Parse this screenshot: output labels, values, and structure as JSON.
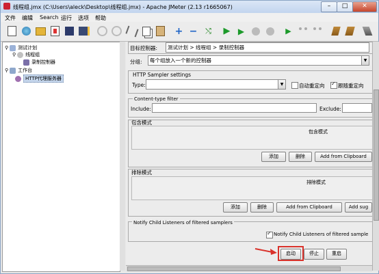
{
  "window": {
    "title": "线程组.jmx (C:\\Users\\aleck\\Desktop\\线程组.jmx) - Apache JMeter (2.13 r1665067)",
    "min_label": "–",
    "max_label": "□",
    "close_label": "✕"
  },
  "menu": [
    "文件",
    "编辑",
    "Search",
    "运行",
    "选项",
    "帮助"
  ],
  "toolbar": {
    "icons": [
      "new-icon",
      "templates-icon",
      "open-icon",
      "close-file-icon",
      "save-icon",
      "save-as-icon",
      "cut-icon",
      "copy-icon",
      "paste-icon",
      "expand-icon",
      "collapse-icon",
      "toggle-icon",
      "start-icon",
      "start-no-pause-icon",
      "stop-icon",
      "shutdown-icon",
      "remote-start-icon",
      "remote-stop-icon",
      "remote-shutdown-icon",
      "clear-icon",
      "clear-all-icon",
      "search-icon"
    ]
  },
  "tree": {
    "nodes": [
      {
        "label": "测试计划",
        "icon": "test-plan-icon"
      },
      {
        "label": "线程组",
        "icon": "thread-group-icon"
      },
      {
        "label": "录制控制器",
        "icon": "recording-controller-icon"
      },
      {
        "label": "工作台",
        "icon": "workbench-icon"
      },
      {
        "label": "HTTP代理服务器",
        "icon": "http-proxy-icon"
      }
    ]
  },
  "form": {
    "target_label": "目标控制器:",
    "target_value": "测试计划 > 线程组 > 录制控制器",
    "grouping_label": "分组:",
    "grouping_value": "每个组放入一个新的控制器",
    "sampler_settings_title": "HTTP Sampler settings",
    "type_label": "Type:",
    "type_value": "",
    "redirect_label": "自动重定向",
    "follow_redirect_label": "跟随重定向",
    "content_filter_title": "Content-type filter",
    "include_label": "Include:",
    "exclude_label": "Exclude:",
    "include_section_title": "包含模式",
    "include_column": "包含模式",
    "exclude_section_title": "排除模式",
    "exclude_column": "排除模式",
    "add_label": "添加",
    "delete_label": "删除",
    "add_clipboard_label": "Add from Clipboard",
    "add_suggested_label": "Add sug",
    "notify_section_title": "Notify Child Listeners of filtered samplers",
    "notify_checkbox_label": "Notify Child Listeners of filtered sample",
    "start_label": "启动",
    "stop_label": "停止",
    "restart_label": "重启"
  },
  "colors": {
    "titlebar": "#c2d5ee",
    "selection": "#c5d6ec",
    "highlight_box": "#d9322b",
    "arrow": "#d9322b"
  }
}
